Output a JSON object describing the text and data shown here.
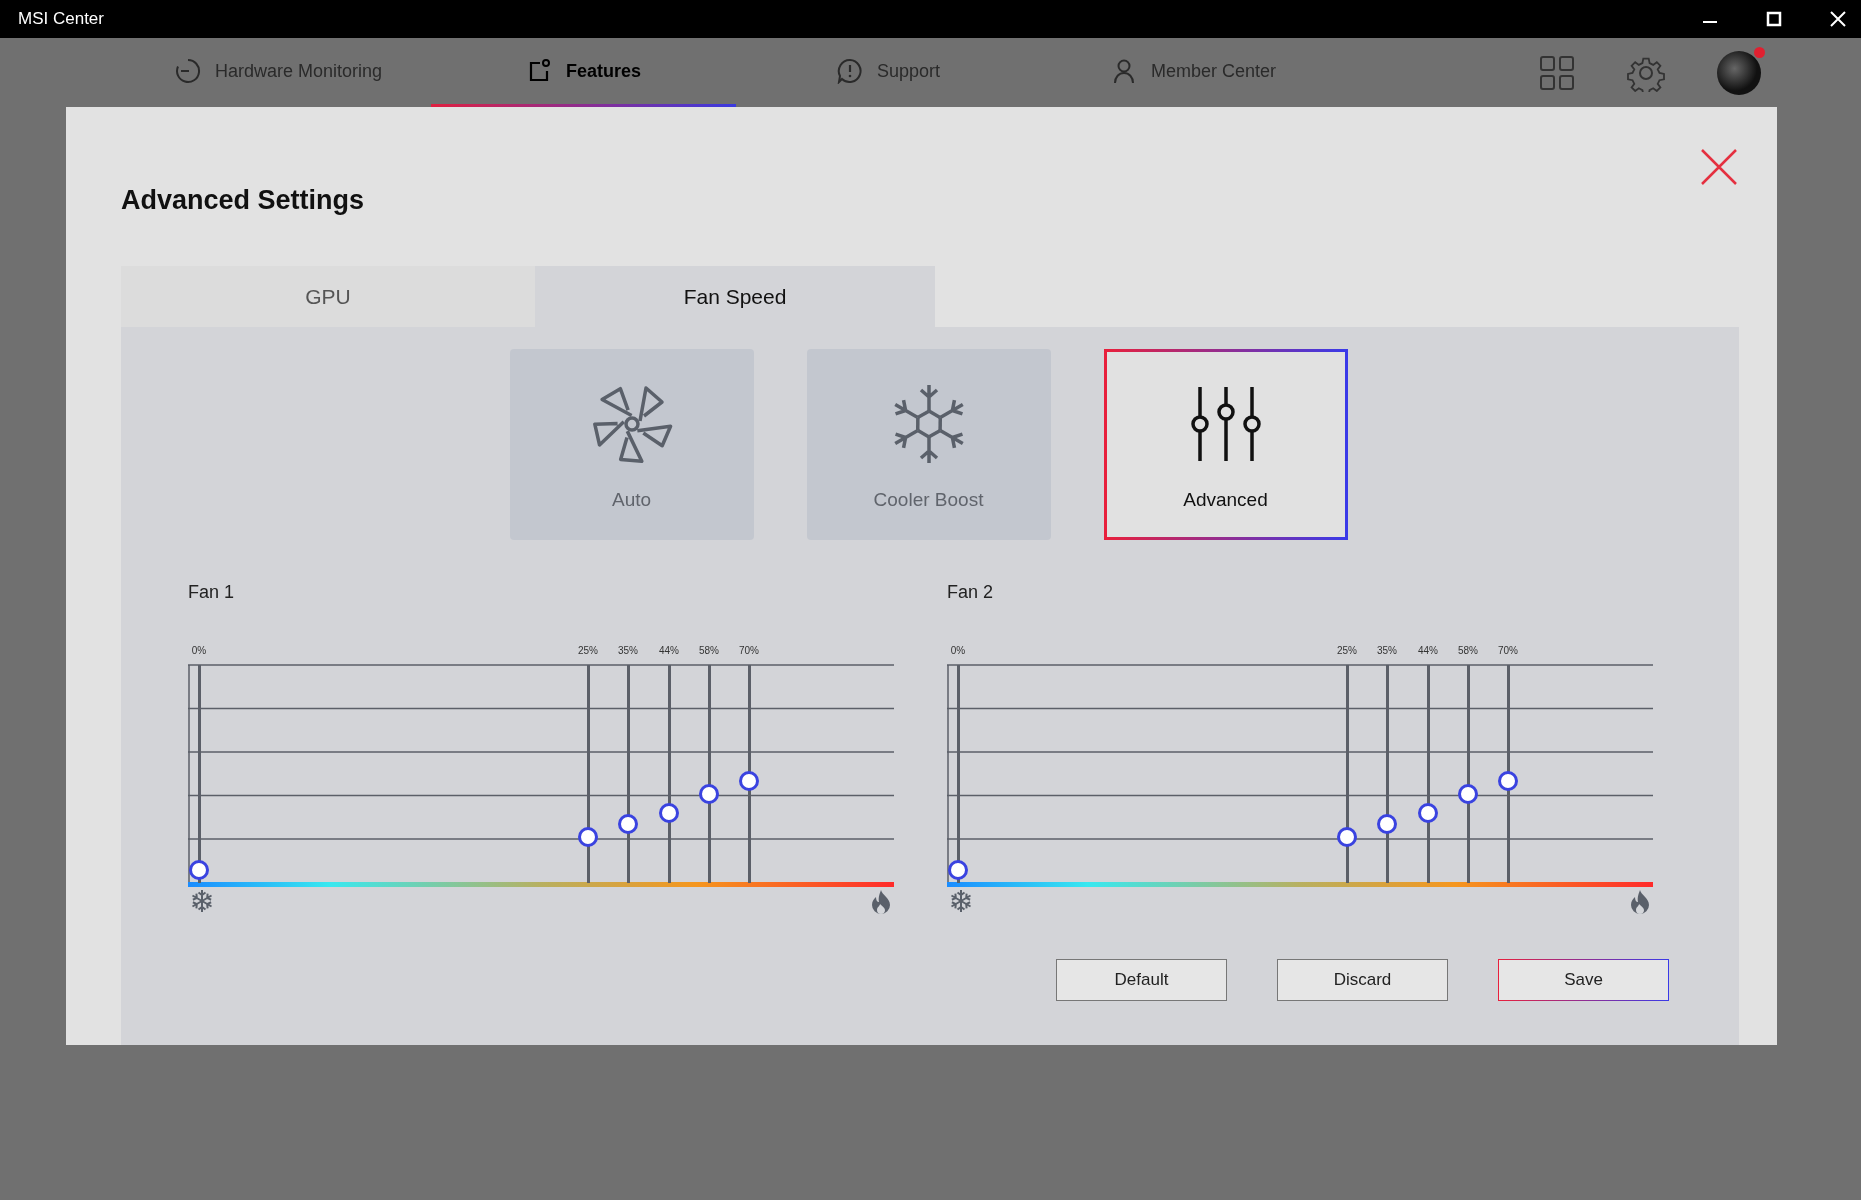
{
  "window": {
    "title": "MSI Center"
  },
  "nav_tabs": [
    {
      "label": "Hardware Monitoring",
      "selected": false
    },
    {
      "label": "Features",
      "selected": true
    },
    {
      "label": "Support",
      "selected": false
    },
    {
      "label": "Member Center",
      "selected": false
    }
  ],
  "dialog": {
    "title": "Advanced Settings",
    "tabs": [
      {
        "label": "GPU",
        "selected": false
      },
      {
        "label": "Fan Speed",
        "selected": true
      }
    ],
    "modes": [
      {
        "label": "Auto",
        "selected": false
      },
      {
        "label": "Cooler Boost",
        "selected": false
      },
      {
        "label": "Advanced",
        "selected": true
      }
    ],
    "fans": [
      {
        "name": "Fan 1",
        "points": [
          {
            "label": "0%",
            "level": 0.06
          },
          {
            "label": "25%",
            "level": 0.21
          },
          {
            "label": "35%",
            "level": 0.27
          },
          {
            "label": "44%",
            "level": 0.32
          },
          {
            "label": "58%",
            "level": 0.41
          },
          {
            "label": "70%",
            "level": 0.47
          }
        ]
      },
      {
        "name": "Fan 2",
        "points": [
          {
            "label": "0%",
            "level": 0.06
          },
          {
            "label": "25%",
            "level": 0.21
          },
          {
            "label": "35%",
            "level": 0.27
          },
          {
            "label": "44%",
            "level": 0.32
          },
          {
            "label": "58%",
            "level": 0.41
          },
          {
            "label": "70%",
            "level": 0.47
          }
        ]
      }
    ],
    "buttons": [
      {
        "label": "Default",
        "kind": "plain"
      },
      {
        "label": "Discard",
        "kind": "plain"
      },
      {
        "label": "Save",
        "kind": "primary"
      }
    ]
  }
}
